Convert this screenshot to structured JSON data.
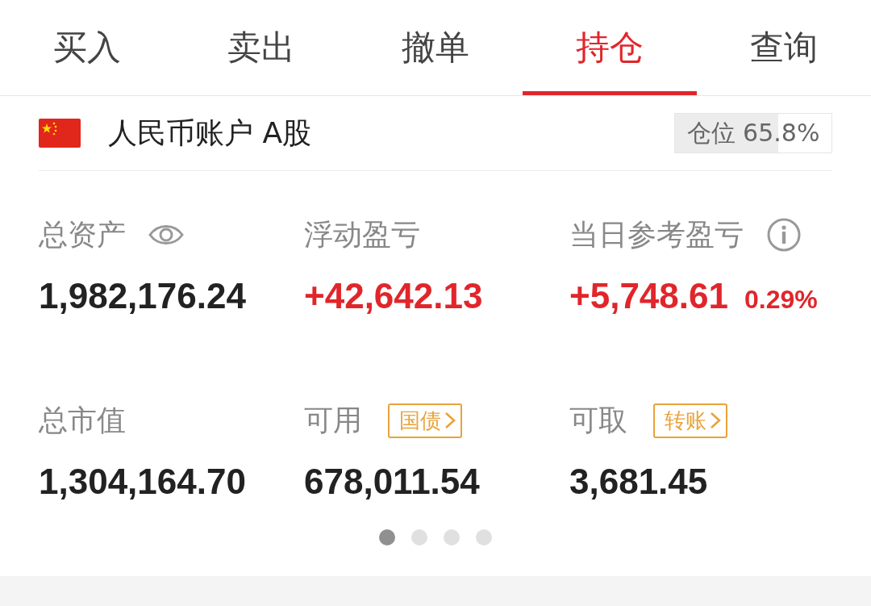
{
  "tabs": [
    {
      "label": "买入",
      "selected": false
    },
    {
      "label": "卖出",
      "selected": false
    },
    {
      "label": "撤单",
      "selected": false
    },
    {
      "label": "持仓",
      "selected": true
    },
    {
      "label": "查询",
      "selected": false
    }
  ],
  "account": {
    "name": "人民币账户 A股",
    "position": {
      "label": "仓位",
      "value": "65.8%",
      "level": 0.658
    }
  },
  "stats": [
    {
      "label": "总资产",
      "kind": "visibility",
      "value": "1,982,176.24",
      "color": "#222222"
    },
    {
      "label": "浮动盈亏",
      "kind": "plain",
      "value": "+42,642.13",
      "color": "#e0262b"
    },
    {
      "label": "当日参考盈亏",
      "kind": "info",
      "value": "+5,748.61",
      "extra": "0.29%",
      "color": "#e0262b"
    },
    {
      "label": "总市值",
      "kind": "plain",
      "value": "1,304,164.70",
      "color": "#222222"
    },
    {
      "label": "可用",
      "kind": "link",
      "tag": "国债",
      "value": "678,011.54",
      "color": "#222222"
    },
    {
      "label": "可取",
      "kind": "link",
      "tag": "转账",
      "value": "3,681.45",
      "color": "#222222"
    }
  ],
  "pages": [
    {
      "selected": true
    },
    {
      "selected": false
    },
    {
      "selected": false
    },
    {
      "selected": false
    }
  ]
}
